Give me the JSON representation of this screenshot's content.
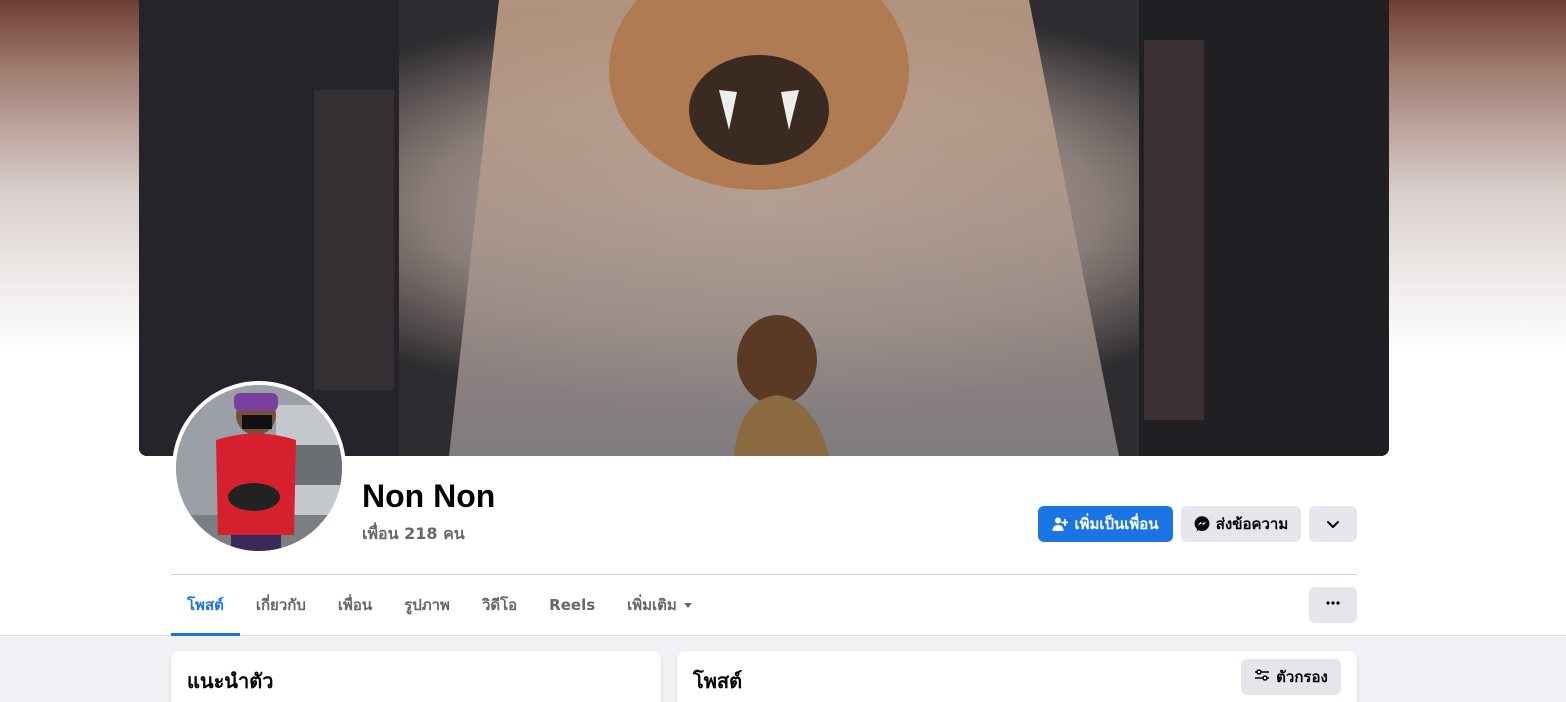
{
  "profile": {
    "name": "Non Non",
    "friends_count_text": "เพื่อน 218 คน"
  },
  "actions": {
    "add_friend_label": "เพิ่มเป็นเพื่อน",
    "message_label": "ส่งข้อความ"
  },
  "tabs": [
    {
      "label": "โพสต์",
      "active": true
    },
    {
      "label": "เกี่ยวกับ",
      "active": false
    },
    {
      "label": "เพื่อน",
      "active": false
    },
    {
      "label": "รูปภาพ",
      "active": false
    },
    {
      "label": "วิดีโอ",
      "active": false
    },
    {
      "label": "Reels",
      "active": false
    },
    {
      "label": "เพิ่มเติม",
      "active": false
    }
  ],
  "intro_card": {
    "title": "แนะนำตัว"
  },
  "posts_card": {
    "title": "โพสต์",
    "filter_label": "ตัวกรอง"
  },
  "colors": {
    "accent": "#1b74e4",
    "secondary_button": "#e4e6eb",
    "page_background": "#f0f2f5"
  },
  "icons": {
    "add_friend": "person-plus-icon",
    "message": "messenger-icon",
    "dropdown": "chevron-down-icon",
    "more": "ellipsis-icon",
    "filter": "sliders-icon",
    "tab_more": "caret-down-icon"
  }
}
